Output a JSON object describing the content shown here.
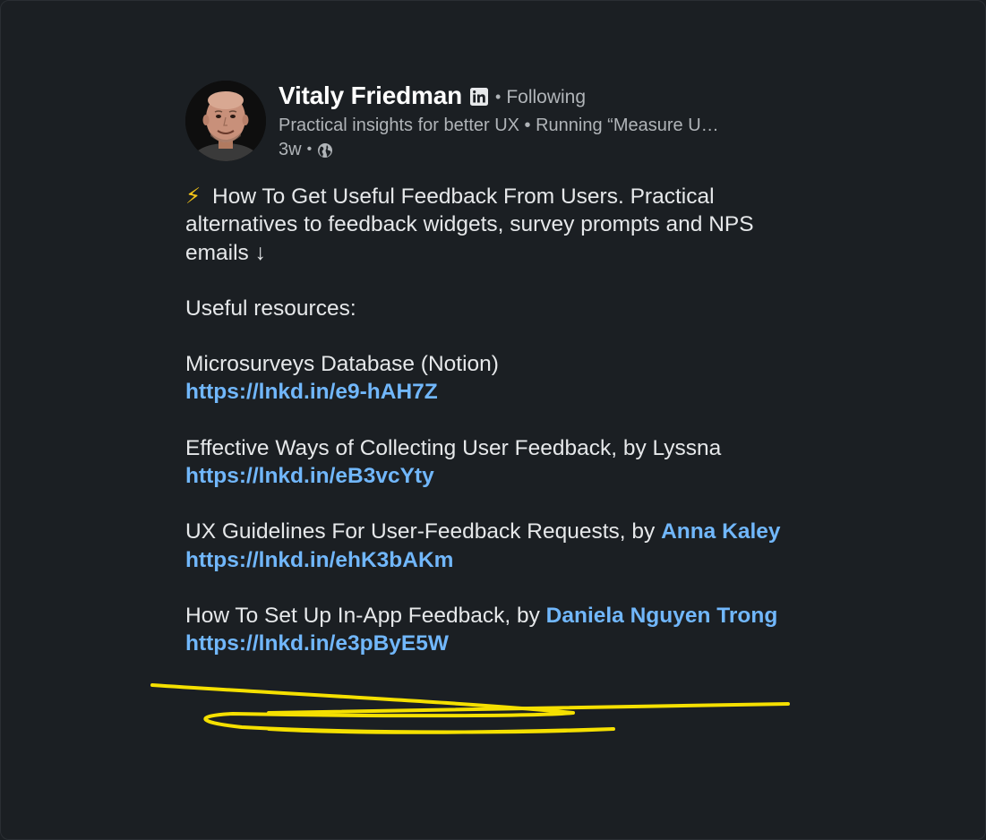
{
  "author": {
    "name": "Vitaly Friedman",
    "separator": "•",
    "follow_status": "Following",
    "headline": "Practical insights for better UX • Running “Measure U…",
    "time": "3w",
    "time_separator": "•",
    "icons": {
      "badge": "linkedin-icon",
      "visibility": "globe-icon"
    }
  },
  "post": {
    "intro_icon": "⚡",
    "intro_text": "How To Get Useful Feedback From Users. Practical alternatives to feedback widgets, survey prompts and NPS emails ↓",
    "resources_heading": "Useful resources:",
    "resources": [
      {
        "title": "Microsurveys Database (Notion)",
        "mention": "",
        "url": "https://lnkd.in/e9-hAH7Z"
      },
      {
        "title": "Effective Ways of Collecting User Feedback, by Lyssna",
        "mention": "",
        "url": "https://lnkd.in/eB3vcYty"
      },
      {
        "title": "UX Guidelines For User-Feedback Requests, by ",
        "mention": "Anna Kaley",
        "url": "https://lnkd.in/ehK3bAKm"
      },
      {
        "title": "How To Set Up In-App Feedback, by ",
        "mention": "Daniela Nguyen Trong",
        "url": "https://lnkd.in/e3pByE5W"
      }
    ]
  },
  "colors": {
    "background": "#1b1f23",
    "text": "#e6e8ea",
    "secondary_text": "#b0b4b8",
    "link": "#71b7fb",
    "highlight_scribble": "#f5e000"
  }
}
